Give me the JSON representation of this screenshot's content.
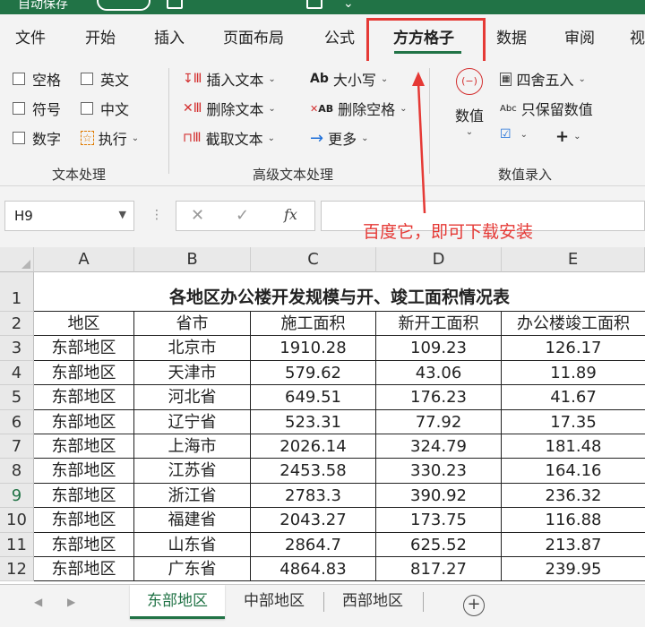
{
  "titlebar": {
    "autosave_label": "自动保存"
  },
  "tabs": [
    {
      "label": "文件"
    },
    {
      "label": "开始"
    },
    {
      "label": "插入"
    },
    {
      "label": "页面布局"
    },
    {
      "label": "公式"
    },
    {
      "label": "方方格子"
    },
    {
      "label": "数据"
    },
    {
      "label": "审阅"
    },
    {
      "label": "视"
    }
  ],
  "ribbon": {
    "text_group": {
      "label": "文本处理",
      "checkboxes": [
        "空格",
        "英文",
        "符号",
        "中文",
        "数字"
      ],
      "execute": "执行"
    },
    "advanced_group": {
      "label": "高级文本处理",
      "insert_text": "插入文本",
      "delete_text": "删除文本",
      "extract_text": "截取文本",
      "case": "大小写",
      "delete_spaces": "删除空格",
      "more": "更多"
    },
    "numeric_group": {
      "label": "数值录入",
      "numeric": "数值",
      "round": "四舍五入",
      "keep_numbers": "只保留数值",
      "abc_prefix": "Abc",
      "ab_prefix": "AB",
      "ab_icon_text": "Ab",
      "plus": "+"
    }
  },
  "formula_bar": {
    "name_box": "H9",
    "fx": "fx",
    "value": ""
  },
  "annotation": "百度它，即可下载安装",
  "sheet": {
    "columns": [
      "A",
      "B",
      "C",
      "D",
      "E"
    ],
    "rows": [
      "1",
      "2",
      "3",
      "4",
      "5",
      "6",
      "7",
      "8",
      "9",
      "10",
      "11",
      "12"
    ],
    "title": "各地区办公楼开发规模与开、竣工面积情况表",
    "headers": [
      "地区",
      "省市",
      "施工面积",
      "新开工面积",
      "办公楼竣工面积"
    ],
    "data": [
      [
        "东部地区",
        "北京市",
        "1910.28",
        "109.23",
        "126.17"
      ],
      [
        "东部地区",
        "天津市",
        "579.62",
        "43.06",
        "11.89"
      ],
      [
        "东部地区",
        "河北省",
        "649.51",
        "176.23",
        "41.67"
      ],
      [
        "东部地区",
        "辽宁省",
        "523.31",
        "77.92",
        "17.35"
      ],
      [
        "东部地区",
        "上海市",
        "2026.14",
        "324.79",
        "181.48"
      ],
      [
        "东部地区",
        "江苏省",
        "2453.58",
        "330.23",
        "164.16"
      ],
      [
        "东部地区",
        "浙江省",
        "2783.3",
        "390.92",
        "236.32"
      ],
      [
        "东部地区",
        "福建省",
        "2043.27",
        "173.75",
        "116.88"
      ],
      [
        "东部地区",
        "山东省",
        "2864.7",
        "625.52",
        "213.87"
      ],
      [
        "东部地区",
        "广东省",
        "4864.83",
        "817.27",
        "239.95"
      ]
    ]
  },
  "sheet_tabs": [
    "东部地区",
    "中部地区",
    "西部地区"
  ],
  "colors": {
    "accent": "#217346",
    "annotation": "#e53935"
  }
}
